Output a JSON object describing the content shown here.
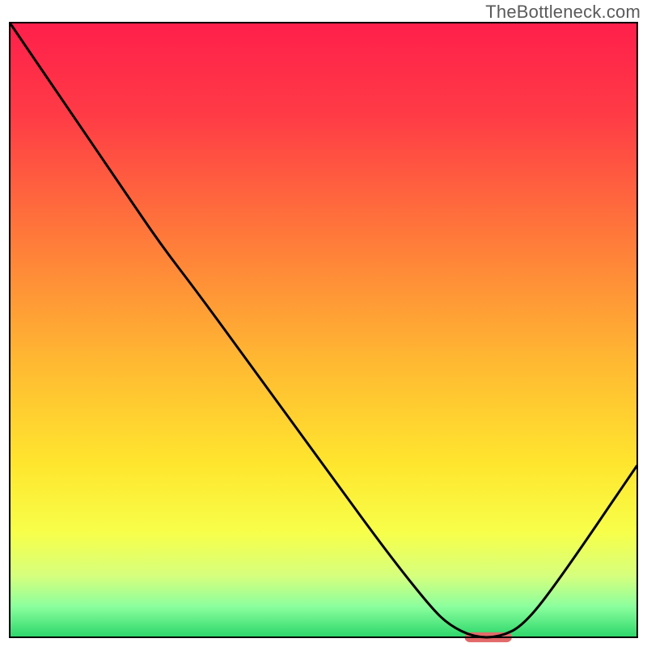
{
  "watermark": "TheBottleneck.com",
  "chart_data": {
    "type": "line",
    "title": "",
    "xlabel": "",
    "ylabel": "",
    "xlim": [
      0,
      100
    ],
    "ylim": [
      0,
      100
    ],
    "grid": false,
    "legend": false,
    "gradient_stops": [
      {
        "offset": 0.0,
        "color": "#ff1f4b"
      },
      {
        "offset": 0.15,
        "color": "#ff3b46"
      },
      {
        "offset": 0.35,
        "color": "#ff7a3a"
      },
      {
        "offset": 0.55,
        "color": "#ffb832"
      },
      {
        "offset": 0.72,
        "color": "#ffe62e"
      },
      {
        "offset": 0.83,
        "color": "#f7ff4a"
      },
      {
        "offset": 0.9,
        "color": "#d6ff7d"
      },
      {
        "offset": 0.95,
        "color": "#8bff9e"
      },
      {
        "offset": 1.0,
        "color": "#2bd66a"
      }
    ],
    "series": [
      {
        "name": "bottleneck-curve",
        "color": "#000000",
        "x": [
          0,
          8,
          18,
          24,
          30,
          40,
          50,
          60,
          67,
          70,
          74,
          78,
          82,
          88,
          100
        ],
        "y": [
          100,
          88,
          73,
          64,
          56,
          42,
          28,
          14,
          5,
          2,
          0,
          0,
          2,
          10,
          28
        ]
      }
    ],
    "marker": {
      "name": "optimal-range-marker",
      "color": "#e26a6a",
      "x_start": 72.5,
      "x_end": 80,
      "y": 0,
      "thickness_pct": 1.6
    }
  }
}
